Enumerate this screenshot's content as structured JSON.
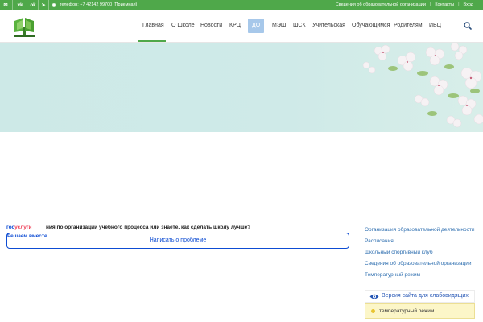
{
  "topbar": {
    "social_icons": [
      "vk-icon",
      "vkontakte-icon",
      "odnoklassniki-icon",
      "rss-icon",
      "telegram-icon"
    ],
    "phone": "телефон: +7 42142 99700 (Приемная)",
    "links": [
      "Сведения об образовательной организации",
      "Контакты",
      "Вход"
    ]
  },
  "nav": {
    "items": [
      "Главная",
      "О Школе",
      "Новости",
      "КРЦ",
      "ДО",
      "МЭШ",
      "ШСК",
      "Учительская",
      "Обучающимся",
      "Родителям",
      "ИВЦ"
    ],
    "active": "Главная",
    "highlighted": "ДО"
  },
  "gosuslugi": {
    "brand_part1": "гос",
    "brand_part2": "услуги",
    "slogan": "Решаем вместе",
    "question": "ния по организации учебного процесса или знаете, как сделать школу лучше?",
    "button": "Написать о проблеме"
  },
  "sidebar": {
    "links": [
      "Организация образовательной деятельности",
      "Расписания",
      "Школьный спортивный клуб",
      "Сведения об образовательной организации",
      "Температурный режим"
    ]
  },
  "accessibility": {
    "label": "Версия сайта для слабовидящих"
  },
  "temperature": {
    "label": "температурный режим"
  },
  "colors": {
    "green": "#4fa84a",
    "link_blue": "#2f6fb0",
    "gos_blue": "#0d4cd3",
    "highlight": "#a7c8ea"
  }
}
